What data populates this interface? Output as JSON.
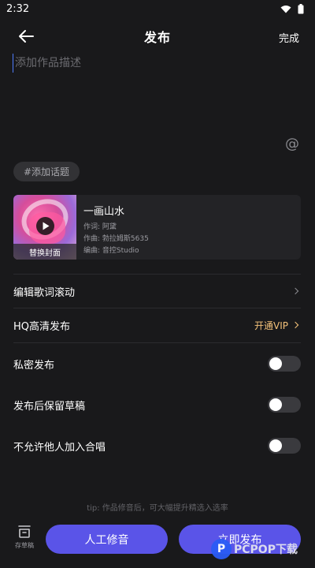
{
  "status_bar": {
    "time": "2:32"
  },
  "header": {
    "title": "发布",
    "done_label": "完成"
  },
  "description": {
    "placeholder": "添加作品描述",
    "value": ""
  },
  "mention_symbol": "@",
  "topic_chip": "#添加话题",
  "song": {
    "title": "一画山水",
    "lyricist": "作词: 阿黛",
    "composer": "作曲: 勃拉姆斯5635",
    "arranger": "编曲: 音控Studio",
    "cover_label": "替换封面"
  },
  "settings": {
    "edit_lyrics_scroll": "编辑歌词滚动",
    "hq_publish": "HQ高清发布",
    "vip_label": "开通VIP",
    "private_publish": "私密发布",
    "private_publish_on": false,
    "keep_draft": "发布后保留草稿",
    "keep_draft_on": false,
    "no_chorus": "不允许他人加入合唱",
    "no_chorus_on": false
  },
  "tip": "tip: 作品修音后，可大幅提升精选入选率",
  "footer": {
    "draft_label": "存草稿",
    "manual_tune": "人工修音",
    "publish_now": "立即发布"
  },
  "watermark": {
    "logo_letter": "P",
    "text": "PCPOP下载"
  }
}
